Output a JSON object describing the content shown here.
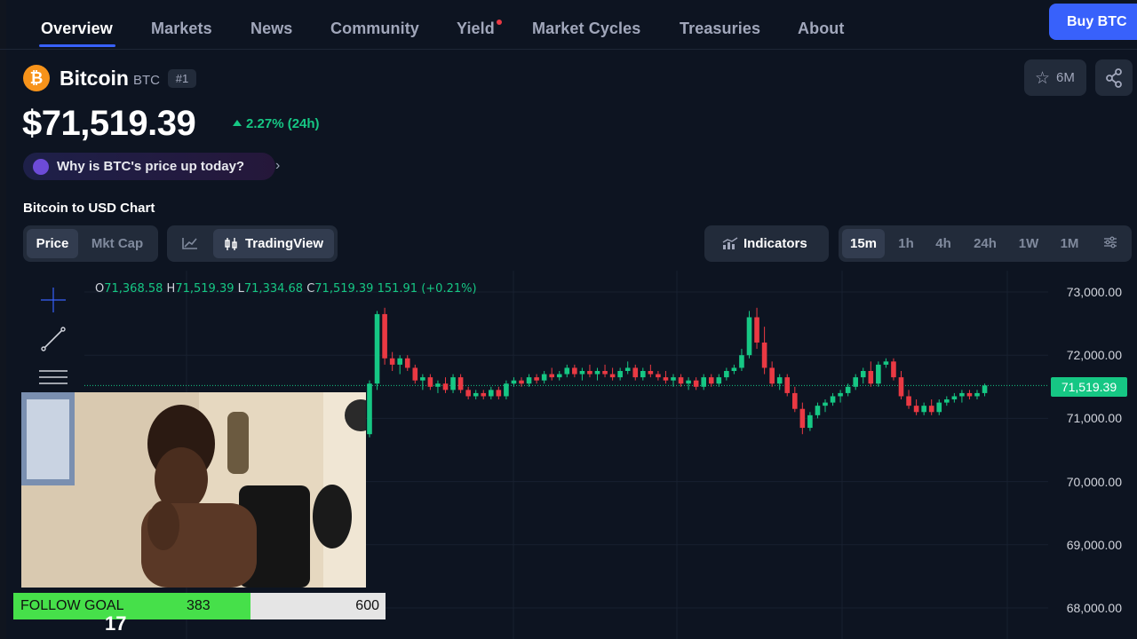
{
  "nav": {
    "items": [
      {
        "label": "Overview",
        "active": true
      },
      {
        "label": "Markets"
      },
      {
        "label": "News"
      },
      {
        "label": "Community"
      },
      {
        "label": "Yield"
      },
      {
        "label": "Market Cycles"
      },
      {
        "label": "Treasuries"
      },
      {
        "label": "About"
      }
    ],
    "buy_label": "Buy BTC"
  },
  "coin": {
    "logo_glyph": "₿",
    "name": "Bitcoin",
    "symbol": "BTC",
    "rank": "#1",
    "watchlist_count": "6M",
    "price": "$71,519.39",
    "change": "2.27% (24h)",
    "why_text": "Why is BTC's price up today?",
    "chevron": "›"
  },
  "chart_section": {
    "title": "Bitcoin to USD Chart",
    "type_tabs": [
      {
        "label": "Price",
        "active": true
      },
      {
        "label": "Mkt Cap"
      }
    ],
    "view_tabs": [
      {
        "label": "TradingView",
        "active": true
      }
    ],
    "indicators_label": "Indicators",
    "timeframes": [
      {
        "label": "15m",
        "active": true
      },
      {
        "label": "1h"
      },
      {
        "label": "4h"
      },
      {
        "label": "24h"
      },
      {
        "label": "1W"
      },
      {
        "label": "1M"
      }
    ]
  },
  "ohlc": {
    "o_label": "O",
    "o": "71,368.58",
    "h_label": "H",
    "h": "71,519.39",
    "l_label": "L",
    "l": "71,334.68",
    "c_label": "C",
    "c": "71,519.39",
    "change": "151.91 (+0.21%)"
  },
  "chart_data": {
    "type": "candlestick",
    "y_ticks": [
      "73,000.00",
      "72,000.00",
      "71,000.00",
      "70,000.00",
      "69,000.00",
      "68,000.00"
    ],
    "ylim": [
      67800,
      73100
    ],
    "last_price": 71519.39,
    "last_price_label": "71,519.39",
    "candles": [
      [
        70750,
        71600,
        70700,
        71550
      ],
      [
        71550,
        72700,
        71450,
        72650
      ],
      [
        72650,
        72750,
        71850,
        71950
      ],
      [
        71950,
        72050,
        71750,
        71850
      ],
      [
        71850,
        72000,
        71700,
        71950
      ],
      [
        71950,
        72000,
        71750,
        71800
      ],
      [
        71800,
        71850,
        71550,
        71600
      ],
      [
        71600,
        71700,
        71450,
        71650
      ],
      [
        71650,
        71700,
        71450,
        71500
      ],
      [
        71500,
        71600,
        71400,
        71550
      ],
      [
        71550,
        71650,
        71400,
        71450
      ],
      [
        71450,
        71700,
        71400,
        71650
      ],
      [
        71650,
        71700,
        71400,
        71450
      ],
      [
        71450,
        71500,
        71300,
        71350
      ],
      [
        71350,
        71450,
        71300,
        71400
      ],
      [
        71400,
        71450,
        71300,
        71350
      ],
      [
        71350,
        71500,
        71300,
        71450
      ],
      [
        71450,
        71500,
        71300,
        71350
      ],
      [
        71350,
        71600,
        71300,
        71550
      ],
      [
        71550,
        71650,
        71500,
        71600
      ],
      [
        71600,
        71650,
        71500,
        71550
      ],
      [
        71550,
        71700,
        71500,
        71650
      ],
      [
        71650,
        71700,
        71550,
        71600
      ],
      [
        71600,
        71750,
        71550,
        71700
      ],
      [
        71700,
        71800,
        71600,
        71650
      ],
      [
        71650,
        71750,
        71600,
        71700
      ],
      [
        71700,
        71850,
        71650,
        71800
      ],
      [
        71800,
        71850,
        71650,
        71700
      ],
      [
        71700,
        71800,
        71600,
        71750
      ],
      [
        71750,
        71850,
        71650,
        71700
      ],
      [
        71700,
        71800,
        71600,
        71750
      ],
      [
        71750,
        71850,
        71650,
        71700
      ],
      [
        71700,
        71800,
        71600,
        71650
      ],
      [
        71650,
        71800,
        71600,
        71750
      ],
      [
        71750,
        71900,
        71700,
        71800
      ],
      [
        71800,
        71850,
        71600,
        71650
      ],
      [
        71650,
        71800,
        71600,
        71750
      ],
      [
        71750,
        71850,
        71650,
        71700
      ],
      [
        71700,
        71750,
        71600,
        71650
      ],
      [
        71650,
        71750,
        71550,
        71600
      ],
      [
        71600,
        71700,
        71500,
        71650
      ],
      [
        71650,
        71700,
        71500,
        71550
      ],
      [
        71550,
        71650,
        71450,
        71600
      ],
      [
        71600,
        71650,
        71450,
        71500
      ],
      [
        71500,
        71700,
        71450,
        71650
      ],
      [
        71650,
        71700,
        71500,
        71550
      ],
      [
        71550,
        71700,
        71500,
        71650
      ],
      [
        71650,
        71800,
        71600,
        71750
      ],
      [
        71750,
        71850,
        71700,
        71800
      ],
      [
        71800,
        72100,
        71750,
        72000
      ],
      [
        72000,
        72700,
        71950,
        72600
      ],
      [
        72600,
        72750,
        72100,
        72200
      ],
      [
        72200,
        72450,
        71700,
        71800
      ],
      [
        71800,
        71900,
        71500,
        71550
      ],
      [
        71550,
        71700,
        71450,
        71650
      ],
      [
        71650,
        71700,
        71350,
        71400
      ],
      [
        71400,
        71500,
        71100,
        71150
      ],
      [
        71150,
        71250,
        70750,
        70850
      ],
      [
        70850,
        71100,
        70800,
        71050
      ],
      [
        71050,
        71250,
        71000,
        71200
      ],
      [
        71200,
        71300,
        71100,
        71250
      ],
      [
        71250,
        71400,
        71200,
        71350
      ],
      [
        71350,
        71450,
        71250,
        71400
      ],
      [
        71400,
        71550,
        71350,
        71500
      ],
      [
        71500,
        71700,
        71450,
        71650
      ],
      [
        71650,
        71800,
        71550,
        71750
      ],
      [
        71750,
        71900,
        71500,
        71550
      ],
      [
        71550,
        71900,
        71500,
        71850
      ],
      [
        71850,
        71950,
        71800,
        71900
      ],
      [
        71900,
        71950,
        71600,
        71650
      ],
      [
        71650,
        71750,
        71300,
        71350
      ],
      [
        71350,
        71450,
        71150,
        71200
      ],
      [
        71200,
        71300,
        71050,
        71100
      ],
      [
        71100,
        71250,
        71050,
        71200
      ],
      [
        71200,
        71300,
        71050,
        71100
      ],
      [
        71100,
        71300,
        71050,
        71250
      ],
      [
        71250,
        71350,
        71200,
        71300
      ],
      [
        71300,
        71400,
        71250,
        71350
      ],
      [
        71350,
        71450,
        71250,
        71400
      ],
      [
        71400,
        71450,
        71300,
        71350
      ],
      [
        71350,
        71450,
        71300,
        71400
      ],
      [
        71400,
        71550,
        71350,
        71520
      ]
    ]
  },
  "overlay": {
    "goal_label": "FOLLOW GOAL",
    "goal_current": 383,
    "goal_max": 600,
    "goal_current_label": "383",
    "goal_max_label": "600",
    "tv_logo": "17"
  }
}
